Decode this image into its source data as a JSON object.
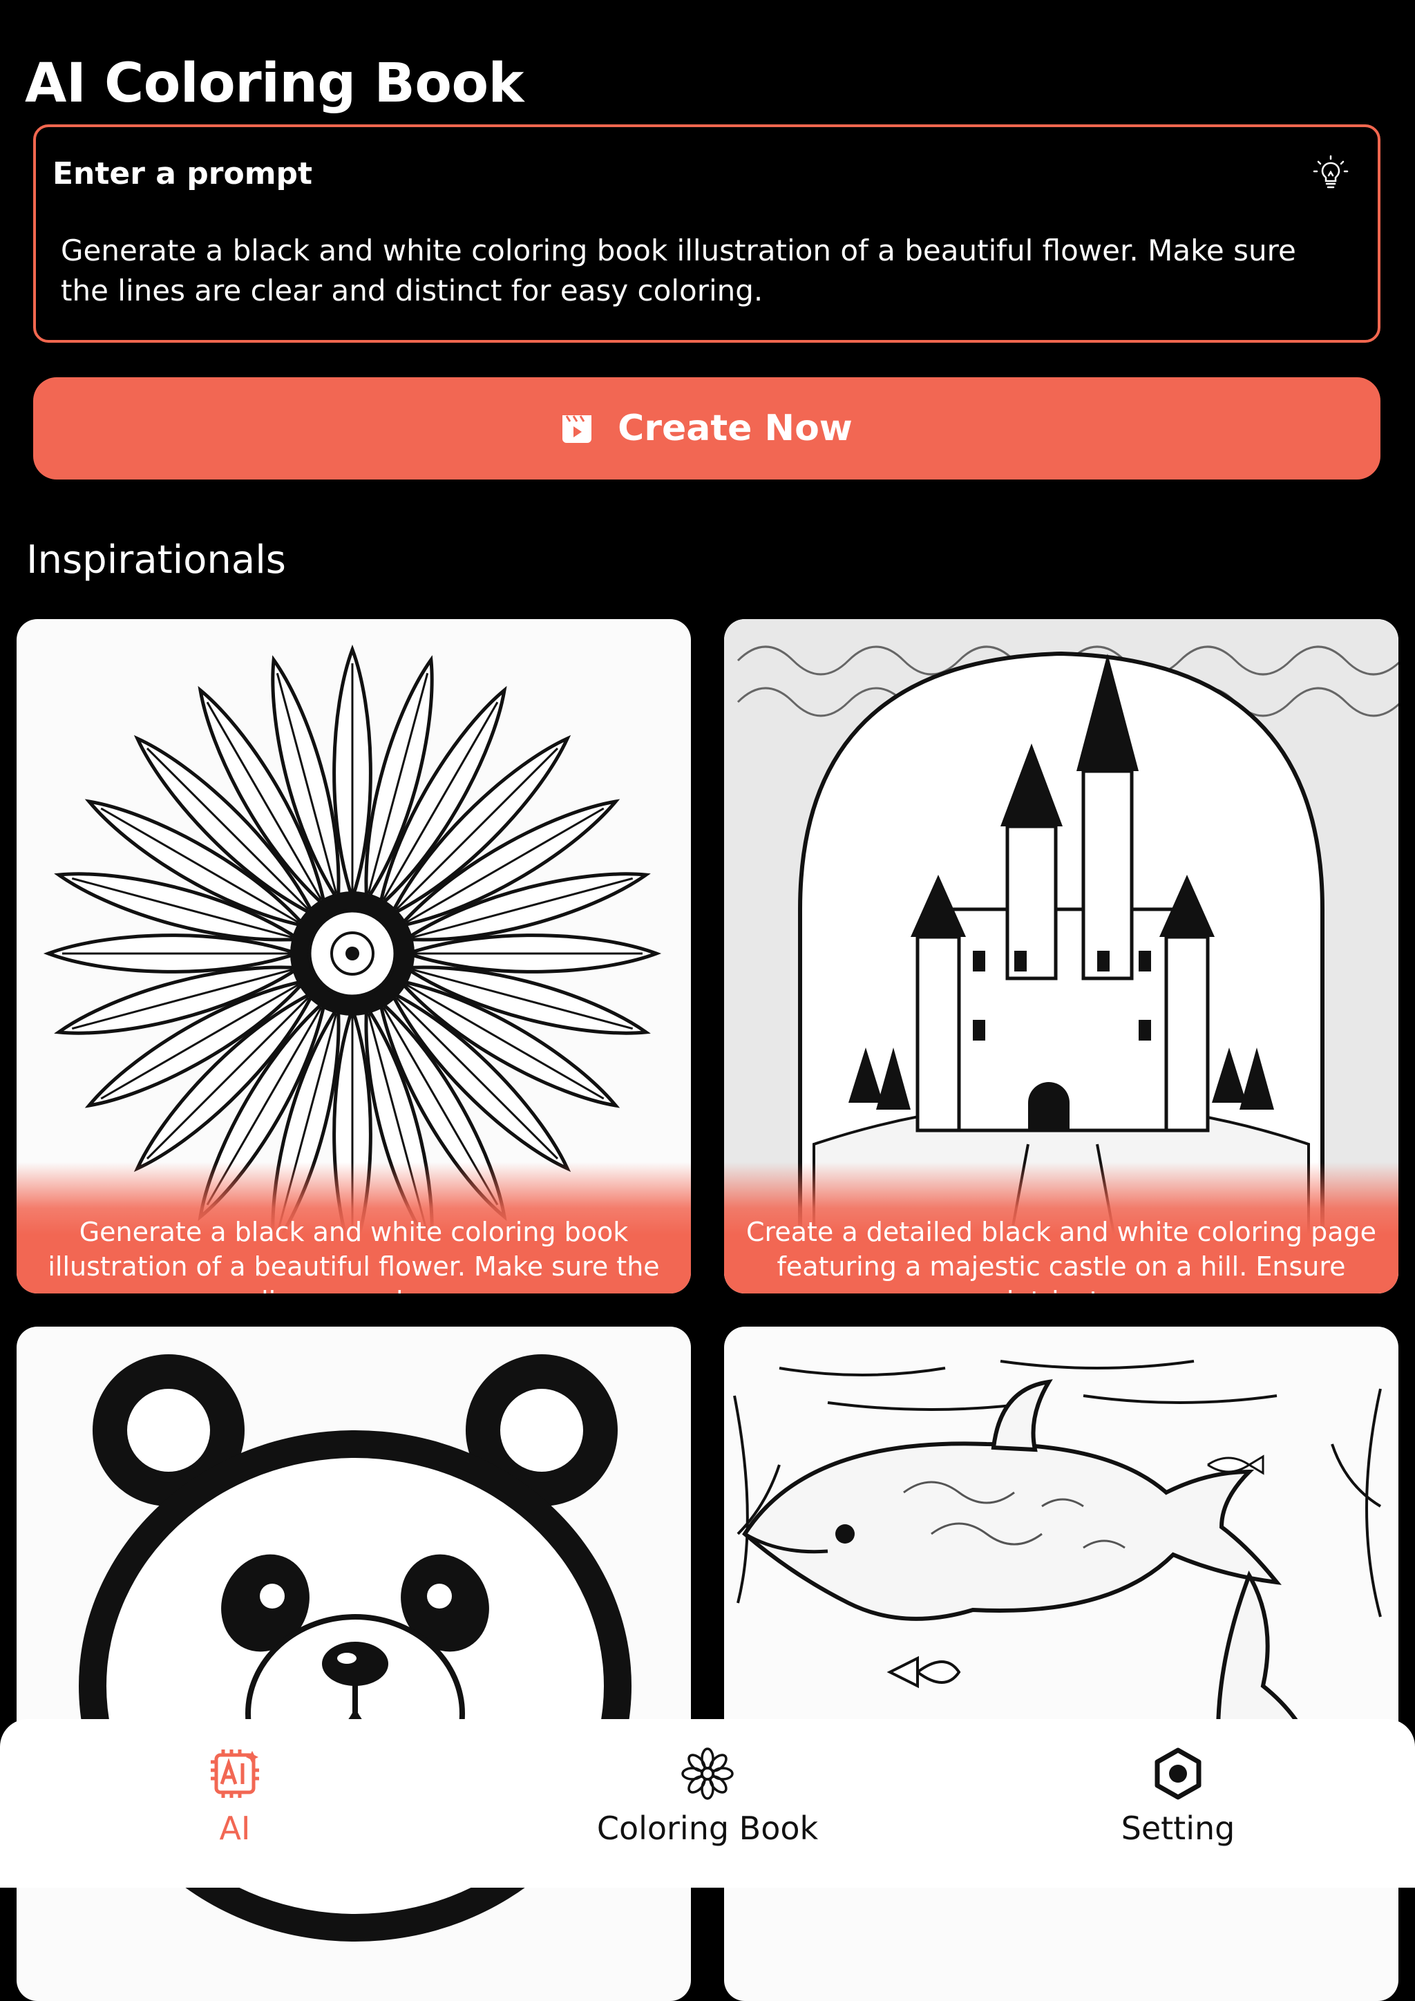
{
  "header": {
    "title": "AI Coloring Book"
  },
  "prompt": {
    "label": "Enter a prompt",
    "value": "Generate a black and white coloring book illustration of a beautiful flower. Make sure the lines are clear and distinct for easy coloring.",
    "hint_icon": "lightbulb-icon"
  },
  "create_button": {
    "label": "Create Now",
    "icon": "video-play-icon"
  },
  "inspirationals": {
    "title": "Inspirationals",
    "cards": [
      {
        "caption": "Generate a black and white coloring book illustration of a beautiful flower. Make sure the lines are clear",
        "image": "flower"
      },
      {
        "caption": "Create a detailed black and white coloring page featuring a majestic castle on a hill. Ensure intricate",
        "image": "castle"
      },
      {
        "caption": "",
        "image": "panda"
      },
      {
        "caption": "",
        "image": "ocean-dolphin"
      }
    ]
  },
  "tabbar": {
    "tabs": [
      {
        "label": "AI",
        "icon": "ai-chip-icon",
        "active": true
      },
      {
        "label": "Coloring Book",
        "icon": "mandala-icon",
        "active": false
      },
      {
        "label": "Setting",
        "icon": "hexagon-settings-icon",
        "active": false
      }
    ]
  },
  "colors": {
    "accent": "#f26753",
    "background": "#000000",
    "tabbar": "#ffffff"
  }
}
